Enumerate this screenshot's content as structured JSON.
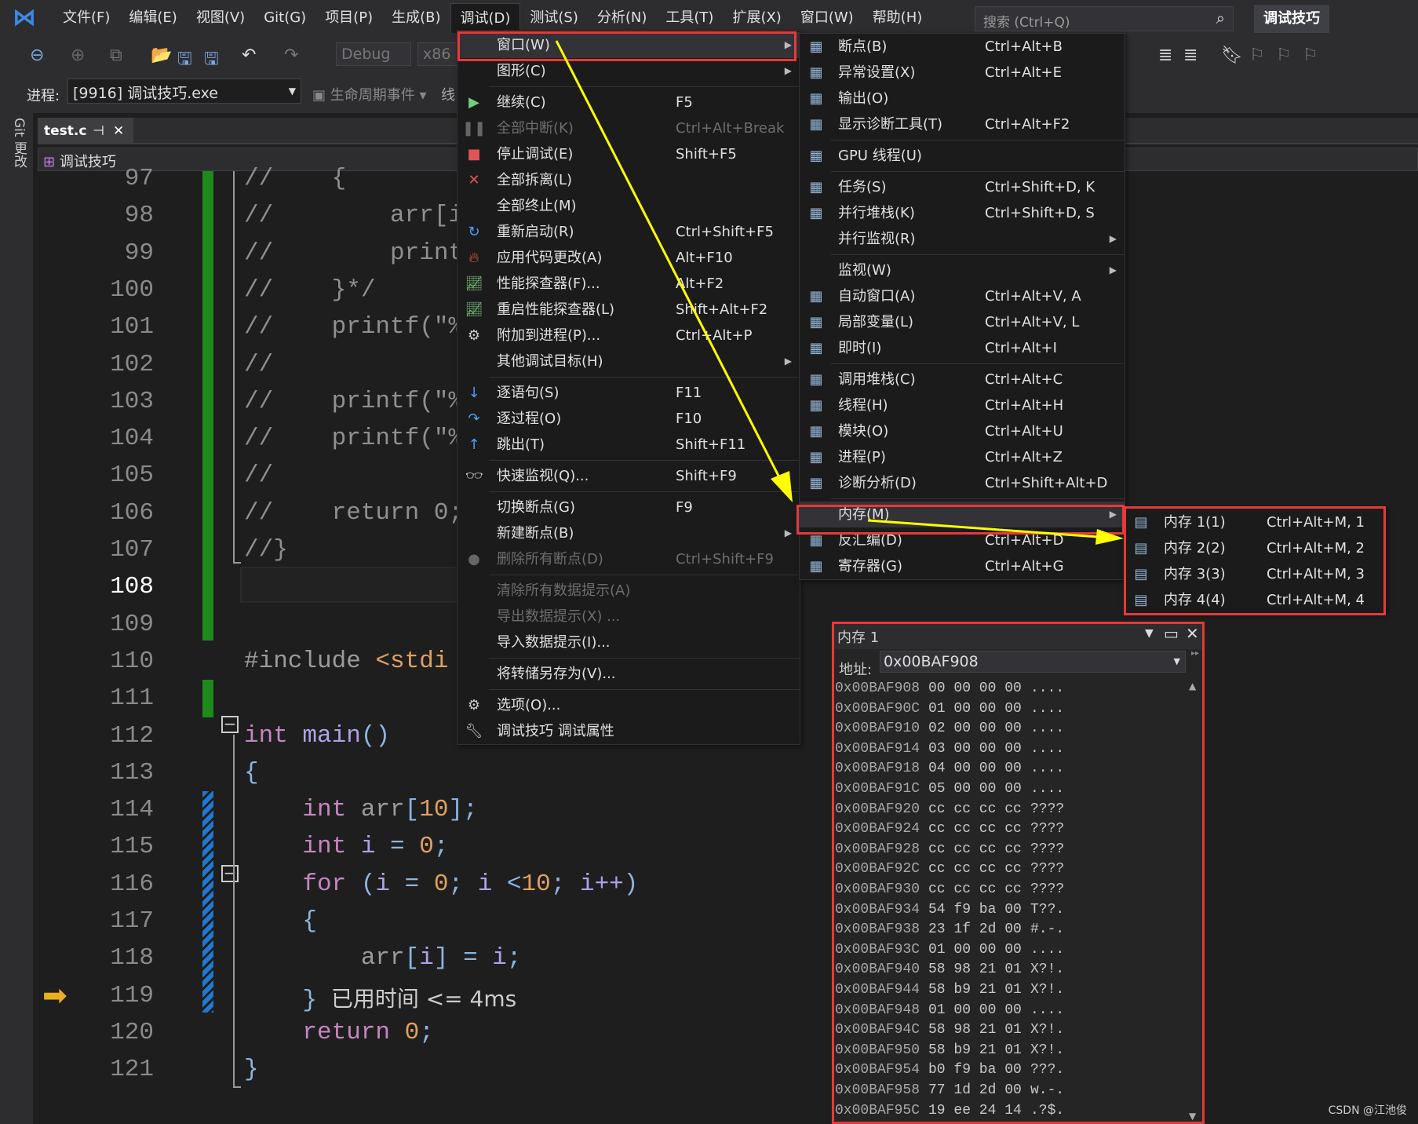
{
  "menubar": {
    "items": [
      "文件(F)",
      "编辑(E)",
      "视图(V)",
      "Git(G)",
      "项目(P)",
      "生成(B)",
      "调试(D)",
      "测试(S)",
      "分析(N)",
      "工具(T)",
      "扩展(X)",
      "窗口(W)",
      "帮助(H)"
    ],
    "active": "调试(D)",
    "search_placeholder": "搜索 (Ctrl+Q)",
    "title": "调试技巧"
  },
  "toolbar": {
    "config": "Debug",
    "platform": "x86",
    "process_label": "进程:",
    "process": "[9916] 调试技巧.exe",
    "lifecycle": "生命周期事件",
    "thread": "线"
  },
  "side": {
    "git": "Git 更改"
  },
  "tab": {
    "name": "test.c",
    "pin": "⊣",
    "close": "✕"
  },
  "navbar": {
    "project": "调试技巧"
  },
  "editor": {
    "current_line": 108,
    "lines": [
      {
        "n": 97,
        "t": [
          [
            "//    {",
            "cm"
          ]
        ]
      },
      {
        "n": 98,
        "t": [
          [
            "//        arr[i]",
            "cm"
          ]
        ]
      },
      {
        "n": 99,
        "t": [
          [
            "//        printf",
            "cm"
          ]
        ]
      },
      {
        "n": 100,
        "t": [
          [
            "//    }*/",
            "cm"
          ]
        ]
      },
      {
        "n": 101,
        "t": [
          [
            "//    printf(\"%p",
            "cm"
          ]
        ]
      },
      {
        "n": 102,
        "t": [
          [
            "//",
            "cm"
          ]
        ]
      },
      {
        "n": 103,
        "t": [
          [
            "//    printf(\"%p",
            "cm"
          ]
        ]
      },
      {
        "n": 104,
        "t": [
          [
            "//    printf(\"%p",
            "cm"
          ]
        ]
      },
      {
        "n": 105,
        "t": [
          [
            "//",
            "cm"
          ]
        ]
      },
      {
        "n": 106,
        "t": [
          [
            "//    return 0;",
            "cm"
          ]
        ]
      },
      {
        "n": 107,
        "t": [
          [
            "//}",
            "cm"
          ]
        ]
      },
      {
        "n": 108,
        "t": []
      },
      {
        "n": 109,
        "t": []
      },
      {
        "n": 110,
        "t": [
          [
            "#include ",
            "pp"
          ],
          [
            "<stdi",
            "nm"
          ]
        ]
      },
      {
        "n": 111,
        "t": []
      },
      {
        "n": 112,
        "t": [
          [
            "int ",
            "kw"
          ],
          [
            "main",
            "fn"
          ],
          [
            "()",
            "br"
          ]
        ]
      },
      {
        "n": 113,
        "t": [
          [
            "{",
            "br"
          ]
        ]
      },
      {
        "n": 114,
        "t": [
          [
            "    int ",
            "kw"
          ],
          [
            "arr",
            "pp"
          ],
          [
            "[",
            "br"
          ],
          [
            "10",
            "nm"
          ],
          [
            "];",
            "br"
          ]
        ]
      },
      {
        "n": 115,
        "t": [
          [
            "    int ",
            "kw"
          ],
          [
            "i ",
            "fn"
          ],
          [
            "= ",
            "br"
          ],
          [
            "0",
            "nm"
          ],
          [
            ";",
            "br"
          ]
        ]
      },
      {
        "n": 116,
        "t": [
          [
            "    for ",
            "kw"
          ],
          [
            "(",
            "br"
          ],
          [
            "i ",
            "fn"
          ],
          [
            "= ",
            "br"
          ],
          [
            "0",
            "nm"
          ],
          [
            "; ",
            "br"
          ],
          [
            "i ",
            "fn"
          ],
          [
            "<",
            "br"
          ],
          [
            "10",
            "nm"
          ],
          [
            "; ",
            "br"
          ],
          [
            "i++",
            "fn"
          ],
          [
            ")",
            "br"
          ]
        ]
      },
      {
        "n": 117,
        "t": [
          [
            "    {",
            "br"
          ]
        ]
      },
      {
        "n": 118,
        "t": [
          [
            "        arr",
            "pp"
          ],
          [
            "[",
            "br"
          ],
          [
            "i",
            "fn"
          ],
          [
            "] = ",
            "br"
          ],
          [
            "i",
            "fn"
          ],
          [
            ";",
            "br"
          ]
        ]
      },
      {
        "n": 119,
        "t": [
          [
            "    }",
            "br"
          ],
          [
            "  已用时间 <= 4ms",
            "hint"
          ]
        ]
      },
      {
        "n": 120,
        "t": [
          [
            "    return ",
            "kw"
          ],
          [
            "0",
            "nm"
          ],
          [
            ";",
            "br"
          ]
        ]
      },
      {
        "n": 121,
        "t": [
          [
            "}",
            "br"
          ]
        ]
      }
    ]
  },
  "debug_menu": {
    "items": [
      {
        "label": "窗口(W)",
        "sub": true,
        "highlight": true
      },
      {
        "label": "图形(C)",
        "sub": true
      },
      {
        "sep": true
      },
      {
        "label": "继续(C)",
        "shortcut": "F5",
        "icon": "play",
        "color": "#6fd17a"
      },
      {
        "label": "全部中断(K)",
        "shortcut": "Ctrl+Alt+Break",
        "icon": "pause",
        "disabled": true
      },
      {
        "label": "停止调试(E)",
        "shortcut": "Shift+F5",
        "icon": "stop",
        "color": "#e05555"
      },
      {
        "label": "全部拆离(L)",
        "icon": "detach",
        "color": "#e05555"
      },
      {
        "label": "全部终止(M)"
      },
      {
        "label": "重新启动(R)",
        "shortcut": "Ctrl+Shift+F5",
        "icon": "restart",
        "color": "#4aa0f0"
      },
      {
        "label": "应用代码更改(A)",
        "shortcut": "Alt+F10",
        "icon": "flame",
        "color": "#e0603a"
      },
      {
        "label": "性能探查器(F)...",
        "shortcut": "Alt+F2",
        "icon": "chart",
        "color": "#7bc47b"
      },
      {
        "label": "重启性能探查器(L)",
        "shortcut": "Shift+Alt+F2",
        "icon": "chart",
        "color": "#7bc47b"
      },
      {
        "label": "附加到进程(P)...",
        "shortcut": "Ctrl+Alt+P",
        "icon": "gears",
        "color": "#ccc"
      },
      {
        "label": "其他调试目标(H)",
        "sub": true
      },
      {
        "sep": true
      },
      {
        "label": "逐语句(S)",
        "shortcut": "F11",
        "icon": "step-into",
        "color": "#4aa0f0"
      },
      {
        "label": "逐过程(O)",
        "shortcut": "F10",
        "icon": "step-over",
        "color": "#4aa0f0"
      },
      {
        "label": "跳出(T)",
        "shortcut": "Shift+F11",
        "icon": "step-out",
        "color": "#4aa0f0"
      },
      {
        "sep": true
      },
      {
        "label": "快速监视(Q)...",
        "shortcut": "Shift+F9",
        "icon": "glasses",
        "color": "#ccc"
      },
      {
        "sep": true
      },
      {
        "label": "切换断点(G)",
        "shortcut": "F9"
      },
      {
        "label": "新建断点(B)",
        "sub": true
      },
      {
        "label": "删除所有断点(D)",
        "shortcut": "Ctrl+Shift+F9",
        "icon": "breakpoints",
        "disabled": true
      },
      {
        "sep": true
      },
      {
        "label": "清除所有数据提示(A)",
        "disabled": true
      },
      {
        "label": "导出数据提示(X) ...",
        "disabled": true
      },
      {
        "label": "导入数据提示(I)..."
      },
      {
        "sep": true
      },
      {
        "label": "将转储另存为(V)..."
      },
      {
        "sep": true
      },
      {
        "label": "选项(O)...",
        "icon": "gear",
        "color": "#ccc"
      },
      {
        "label": "调试技巧 调试属性",
        "icon": "wrench",
        "color": "#ccc"
      }
    ]
  },
  "window_menu": {
    "items": [
      {
        "label": "断点(B)",
        "shortcut": "Ctrl+Alt+B",
        "icon": "breakpoints-window"
      },
      {
        "label": "异常设置(X)",
        "shortcut": "Ctrl+Alt+E",
        "icon": "exception"
      },
      {
        "label": "输出(O)",
        "icon": "output"
      },
      {
        "label": "显示诊断工具(T)",
        "shortcut": "Ctrl+Alt+F2",
        "icon": "diagnostics"
      },
      {
        "sep": true
      },
      {
        "label": "GPU 线程(U)",
        "icon": "gpu-threads"
      },
      {
        "sep": true
      },
      {
        "label": "任务(S)",
        "shortcut": "Ctrl+Shift+D, K",
        "icon": "tasks"
      },
      {
        "label": "并行堆栈(K)",
        "shortcut": "Ctrl+Shift+D, S",
        "icon": "parallel-stacks"
      },
      {
        "label": "并行监视(R)",
        "sub": true
      },
      {
        "sep": true
      },
      {
        "label": "监视(W)",
        "sub": true
      },
      {
        "label": "自动窗口(A)",
        "shortcut": "Ctrl+Alt+V, A",
        "icon": "autos"
      },
      {
        "label": "局部变量(L)",
        "shortcut": "Ctrl+Alt+V, L",
        "icon": "locals"
      },
      {
        "label": "即时(I)",
        "shortcut": "Ctrl+Alt+I",
        "icon": "immediate"
      },
      {
        "sep": true
      },
      {
        "label": "调用堆栈(C)",
        "shortcut": "Ctrl+Alt+C",
        "icon": "call-stack"
      },
      {
        "label": "线程(H)",
        "shortcut": "Ctrl+Alt+H",
        "icon": "threads"
      },
      {
        "label": "模块(O)",
        "shortcut": "Ctrl+Alt+U",
        "icon": "modules"
      },
      {
        "label": "进程(P)",
        "shortcut": "Ctrl+Alt+Z",
        "icon": "processes"
      },
      {
        "label": "诊断分析(D)",
        "shortcut": "Ctrl+Shift+Alt+D",
        "icon": "diagnostic-analysis"
      },
      {
        "sep": true
      },
      {
        "label": "内存(M)",
        "sub": true,
        "highlight": true
      },
      {
        "label": "反汇编(D)",
        "shortcut": "Ctrl+Alt+D",
        "icon": "disassembly"
      },
      {
        "label": "寄存器(G)",
        "shortcut": "Ctrl+Alt+G",
        "icon": "registers"
      }
    ]
  },
  "memory_menu": {
    "items": [
      {
        "label": "内存 1(1)",
        "shortcut": "Ctrl+Alt+M, 1",
        "icon": "memory"
      },
      {
        "label": "内存 2(2)",
        "shortcut": "Ctrl+Alt+M, 2",
        "icon": "memory"
      },
      {
        "label": "内存 3(3)",
        "shortcut": "Ctrl+Alt+M, 3",
        "icon": "memory"
      },
      {
        "label": "内存 4(4)",
        "shortcut": "Ctrl+Alt+M, 4",
        "icon": "memory"
      }
    ]
  },
  "memory_window": {
    "title": "内存 1",
    "address_label": "地址:",
    "address": "0x00BAF908",
    "rows": [
      [
        "0x00BAF908",
        "00 00 00 00",
        "...."
      ],
      [
        "0x00BAF90C",
        "01 00 00 00",
        "...."
      ],
      [
        "0x00BAF910",
        "02 00 00 00",
        "...."
      ],
      [
        "0x00BAF914",
        "03 00 00 00",
        "...."
      ],
      [
        "0x00BAF918",
        "04 00 00 00",
        "...."
      ],
      [
        "0x00BAF91C",
        "05 00 00 00",
        "...."
      ],
      [
        "0x00BAF920",
        "cc cc cc cc",
        "????"
      ],
      [
        "0x00BAF924",
        "cc cc cc cc",
        "????"
      ],
      [
        "0x00BAF928",
        "cc cc cc cc",
        "????"
      ],
      [
        "0x00BAF92C",
        "cc cc cc cc",
        "????"
      ],
      [
        "0x00BAF930",
        "cc cc cc cc",
        "????"
      ],
      [
        "0x00BAF934",
        "54 f9 ba 00",
        "T??."
      ],
      [
        "0x00BAF938",
        "23 1f 2d 00",
        "#.-."
      ],
      [
        "0x00BAF93C",
        "01 00 00 00",
        "...."
      ],
      [
        "0x00BAF940",
        "58 98 21 01",
        "X?!."
      ],
      [
        "0x00BAF944",
        "58 b9 21 01",
        "X?!."
      ],
      [
        "0x00BAF948",
        "01 00 00 00",
        "...."
      ],
      [
        "0x00BAF94C",
        "58 98 21 01",
        "X?!."
      ],
      [
        "0x00BAF950",
        "58 b9 21 01",
        "X?!."
      ],
      [
        "0x00BAF954",
        "b0 f9 ba 00",
        "???."
      ],
      [
        "0x00BAF958",
        "77 1d 2d 00",
        "w.-."
      ],
      [
        "0x00BAF95C",
        "19 ee 24 14",
        ".?$."
      ]
    ]
  },
  "annotation": {
    "arrow_color": "#ffff00",
    "box_color": "#e83838"
  },
  "footer": {
    "credit": "CSDN @江池俊"
  }
}
